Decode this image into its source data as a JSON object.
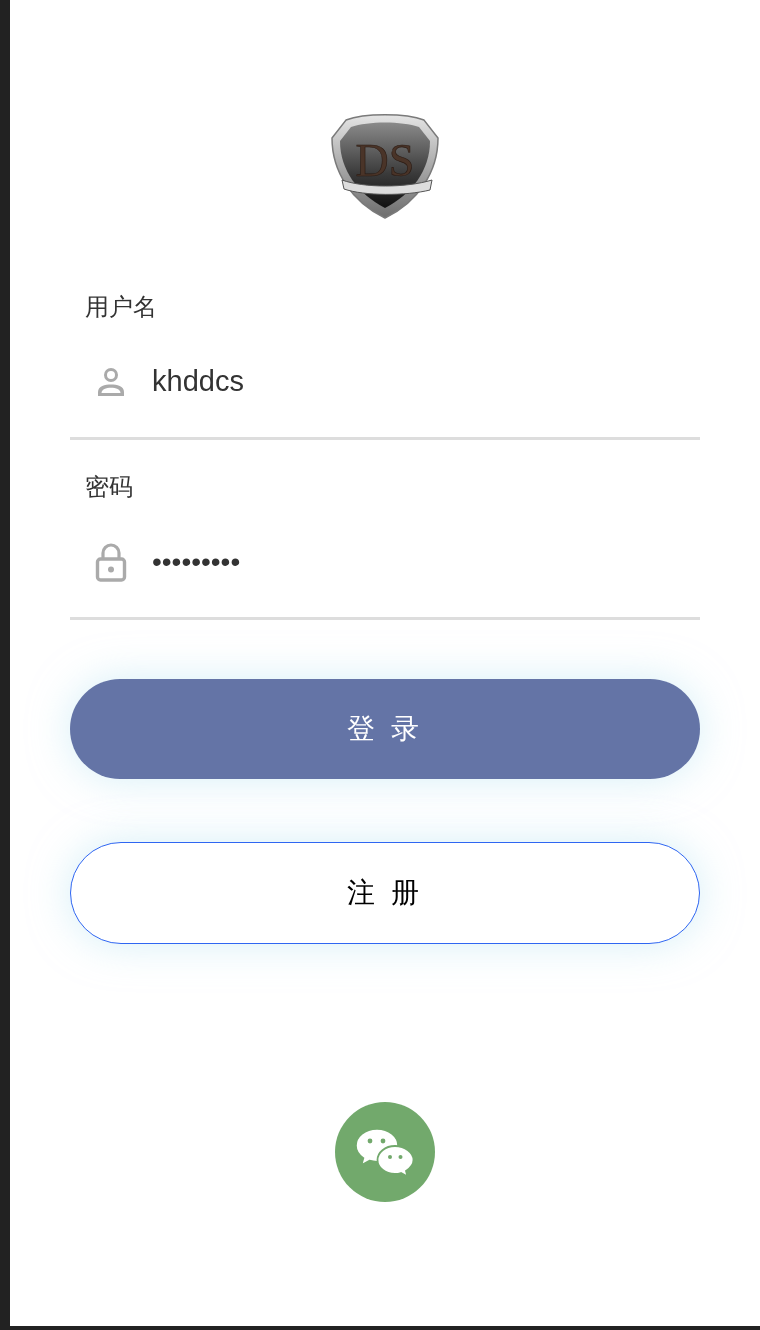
{
  "logo": {
    "text": "DS"
  },
  "fields": [
    {
      "label": "用户名",
      "kind": "user",
      "value": "khddcs"
    },
    {
      "label": "密码",
      "kind": "password",
      "value": "•••••••••"
    }
  ],
  "buttons": [
    {
      "label": "登 录",
      "kind": "primary"
    },
    {
      "label": "注 册",
      "kind": "outline"
    }
  ]
}
